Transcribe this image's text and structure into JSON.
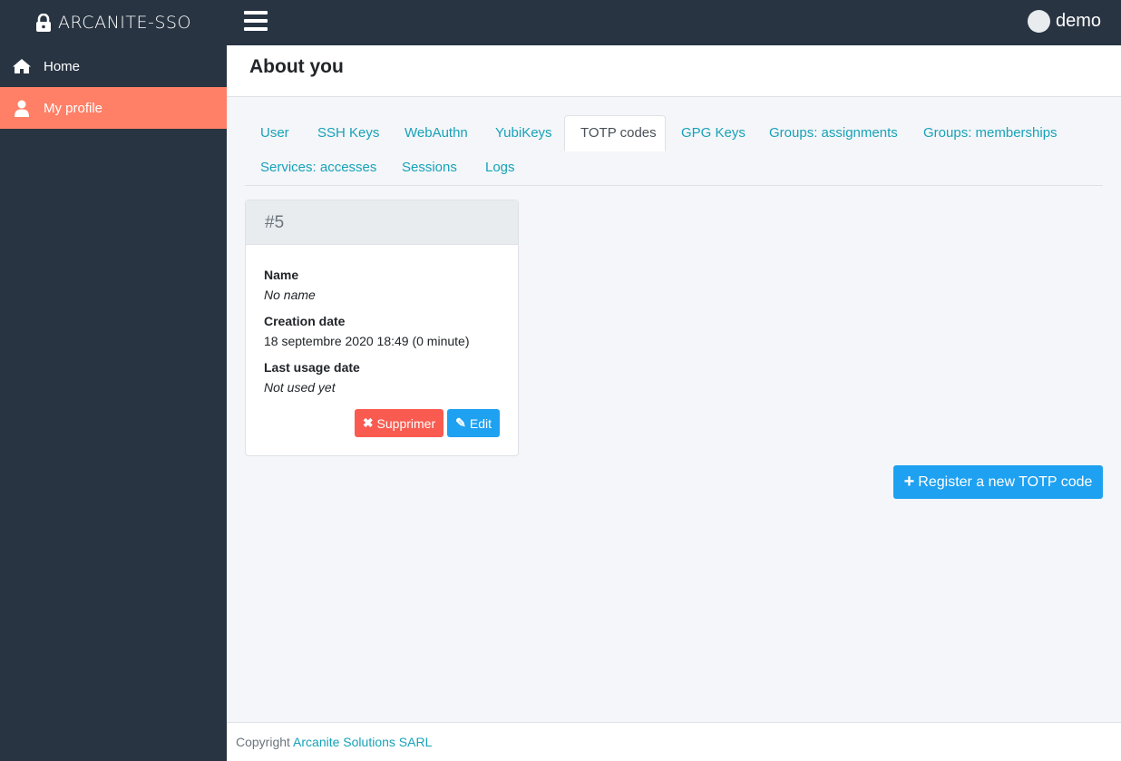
{
  "brand": {
    "name": "ARCANITE-SSO",
    "icon": "lock-icon"
  },
  "header": {
    "menu_icon": "hamburger-icon",
    "user": {
      "name": "demo"
    }
  },
  "sidebar": {
    "items": [
      {
        "label": "Home",
        "icon": "home-icon",
        "active": false
      },
      {
        "label": "My profile",
        "icon": "user-icon",
        "active": true
      }
    ],
    "active_color": "#ff7f67"
  },
  "page": {
    "title": "About you"
  },
  "tabs": [
    {
      "label": "User"
    },
    {
      "label": "SSH Keys"
    },
    {
      "label": "WebAuthn"
    },
    {
      "label": "YubiKeys"
    },
    {
      "label": "TOTP codes",
      "active": true
    },
    {
      "label": "GPG Keys"
    },
    {
      "label": "Groups: assignments"
    },
    {
      "label": "Groups: memberships"
    },
    {
      "label": "Services: accesses"
    },
    {
      "label": "Sessions"
    },
    {
      "label": "Logs"
    }
  ],
  "totp_card": {
    "title": "#5",
    "fields": [
      {
        "label": "Name",
        "value": "No name"
      },
      {
        "label": "Creation date",
        "value": "18 septembre 2020 18:49 (0 minute)"
      },
      {
        "label": "Last usage date",
        "value": "Not used yet"
      }
    ],
    "delete_label": "Supprimer",
    "edit_label": "Edit"
  },
  "register_button": {
    "label": "Register a new TOTP code"
  },
  "footer": {
    "prefix": "Copyright",
    "link_text": "Arcanite Solutions SARL"
  },
  "colors": {
    "dark": "#283442",
    "accent": "#ff7f67",
    "primary": "#1ea1f1",
    "danger": "#f95b50",
    "link": "#17a2b8"
  }
}
